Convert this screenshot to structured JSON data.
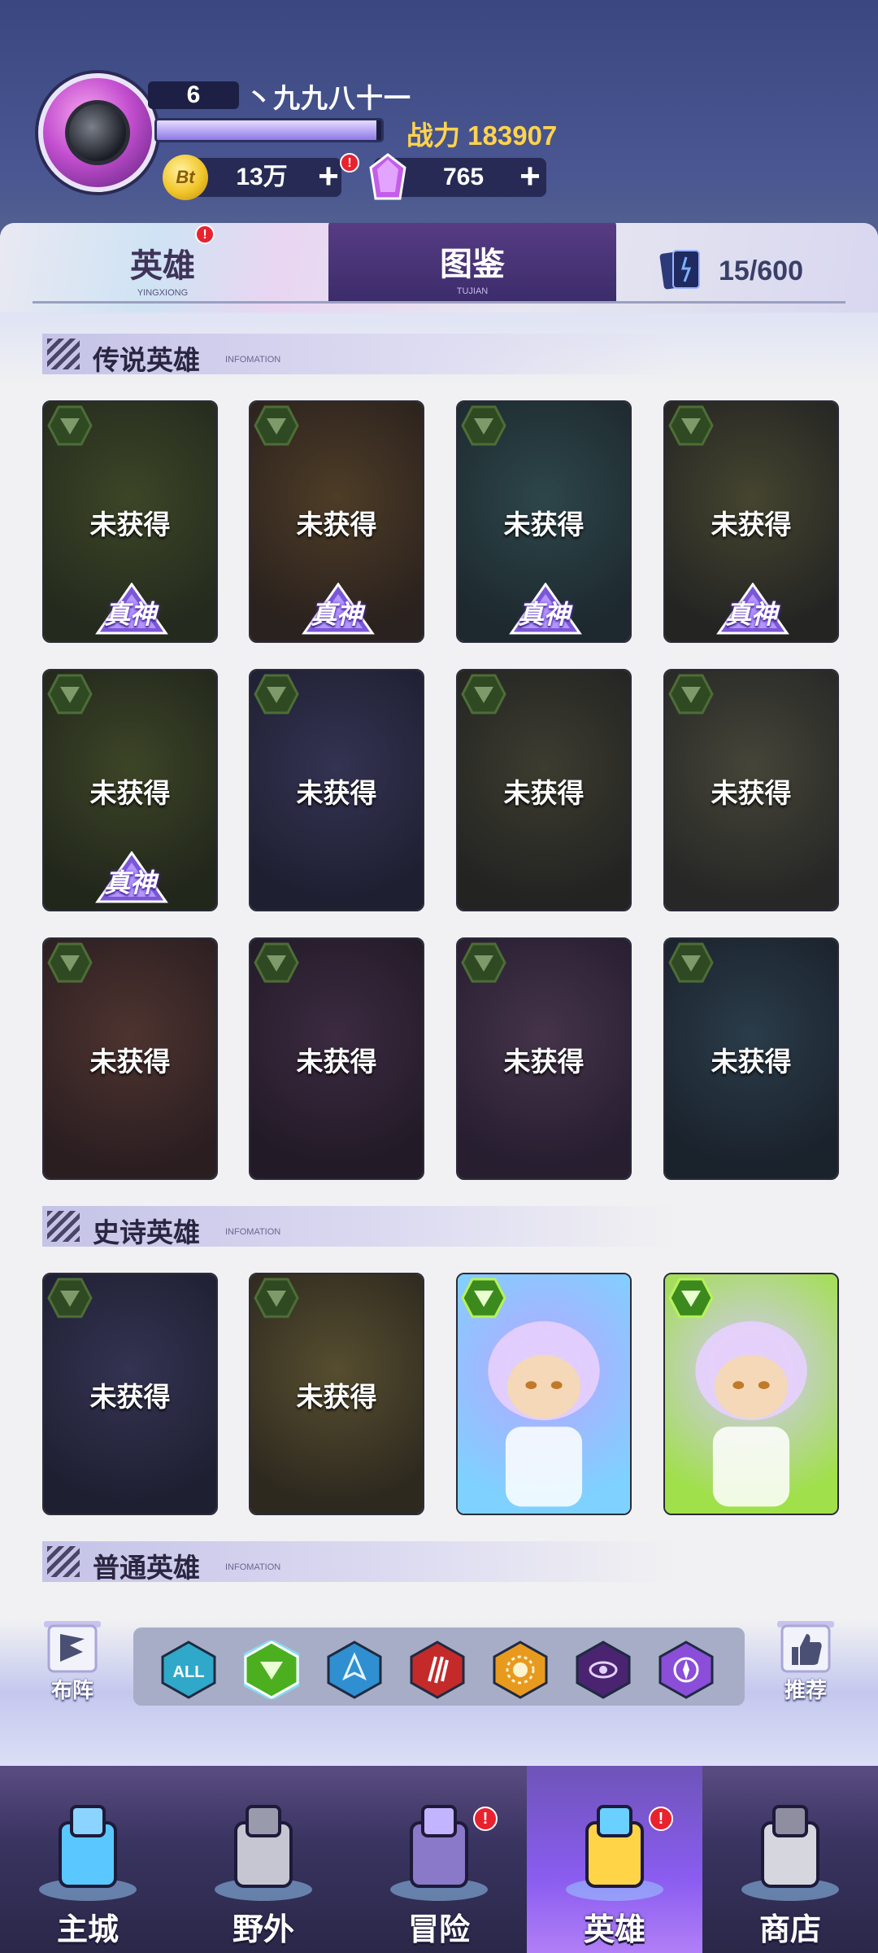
{
  "player": {
    "level": "6",
    "name": "丶九九八十一",
    "exp_fraction": 0.98,
    "power_label": "战力",
    "power_value": "183907",
    "coins": "13万",
    "coin_symbol": "Bt",
    "gems": "765",
    "notice": "!"
  },
  "tabs": {
    "heroes": {
      "label": "英雄",
      "sub": "YINGXIONG"
    },
    "atlas": {
      "label": "图鉴",
      "sub": "TUJIAN"
    },
    "collected": "15/600"
  },
  "sections": {
    "legendary": {
      "title": "传说英雄",
      "sub": "INFOMATION"
    },
    "epic": {
      "title": "史诗英雄",
      "sub": "INFOMATION"
    },
    "common": {
      "title": "普通英雄",
      "sub": "INFOMATION"
    }
  },
  "status_locked": "未获得",
  "tier_label": "真神",
  "legendary_cards": [
    {
      "locked": true,
      "true_god": true,
      "colors": [
        "#5a6b2a",
        "#2f3a1a"
      ]
    },
    {
      "locked": true,
      "true_god": true,
      "colors": [
        "#7a5a2a",
        "#3a2a1a"
      ]
    },
    {
      "locked": true,
      "true_god": true,
      "colors": [
        "#3f6b6a",
        "#223838"
      ]
    },
    {
      "locked": true,
      "true_god": true,
      "colors": [
        "#6a6a3a",
        "#2e2e24"
      ]
    },
    {
      "locked": true,
      "true_god": true,
      "colors": [
        "#5a6a2a",
        "#2a3316"
      ]
    },
    {
      "locked": true,
      "true_god": false,
      "colors": [
        "#4a4a7a",
        "#25253e"
      ]
    },
    {
      "locked": true,
      "true_god": false,
      "colors": [
        "#5a5a3a",
        "#2d2d22"
      ]
    },
    {
      "locked": true,
      "true_god": false,
      "colors": [
        "#6a6a4a",
        "#34342a"
      ]
    },
    {
      "locked": true,
      "true_god": false,
      "colors": [
        "#7a4a3a",
        "#3b2420"
      ]
    },
    {
      "locked": true,
      "true_god": false,
      "colors": [
        "#5a3a5a",
        "#2a1c2a"
      ]
    },
    {
      "locked": true,
      "true_god": false,
      "colors": [
        "#6a4a6a",
        "#33233a"
      ]
    },
    {
      "locked": true,
      "true_god": false,
      "colors": [
        "#3a5a6a",
        "#1c2a33"
      ]
    }
  ],
  "epic_cards": [
    {
      "locked": true,
      "true_god": false,
      "colors": [
        "#4a4a7a",
        "#25253e"
      ]
    },
    {
      "locked": true,
      "true_god": false,
      "colors": [
        "#8a7a3a",
        "#40371c"
      ]
    },
    {
      "locked": false,
      "true_god": false,
      "colors": [
        "#b7a6ff",
        "#7fd1ff"
      ]
    },
    {
      "locked": false,
      "true_god": false,
      "colors": [
        "#d6c8ff",
        "#a0e04a"
      ]
    }
  ],
  "side_buttons": {
    "formation": "布阵",
    "recommend": "推荐"
  },
  "filters": [
    {
      "icon": "all-filter-icon",
      "label": "ALL",
      "color": "#2fa8c9"
    },
    {
      "icon": "nature-faction-icon",
      "label": "",
      "color": "#4caf1f"
    },
    {
      "icon": "water-faction-icon",
      "label": "",
      "color": "#2f8fd0"
    },
    {
      "icon": "claw-faction-icon",
      "label": "",
      "color": "#c42a2a"
    },
    {
      "icon": "sun-faction-icon",
      "label": "",
      "color": "#e89a1f"
    },
    {
      "icon": "dark-eye-faction-icon",
      "label": "",
      "color": "#4a2470"
    },
    {
      "icon": "arcane-faction-icon",
      "label": "",
      "color": "#8a4ed8"
    }
  ],
  "active_filter": 1,
  "nav": [
    {
      "label": "主城",
      "icon": "main-city-icon",
      "badge": false
    },
    {
      "label": "野外",
      "icon": "wilderness-icon",
      "badge": false
    },
    {
      "label": "冒险",
      "icon": "adventure-icon",
      "badge": true
    },
    {
      "label": "英雄",
      "icon": "hero-icon",
      "badge": true
    },
    {
      "label": "商店",
      "icon": "shop-icon",
      "badge": false
    }
  ],
  "active_nav": 3
}
